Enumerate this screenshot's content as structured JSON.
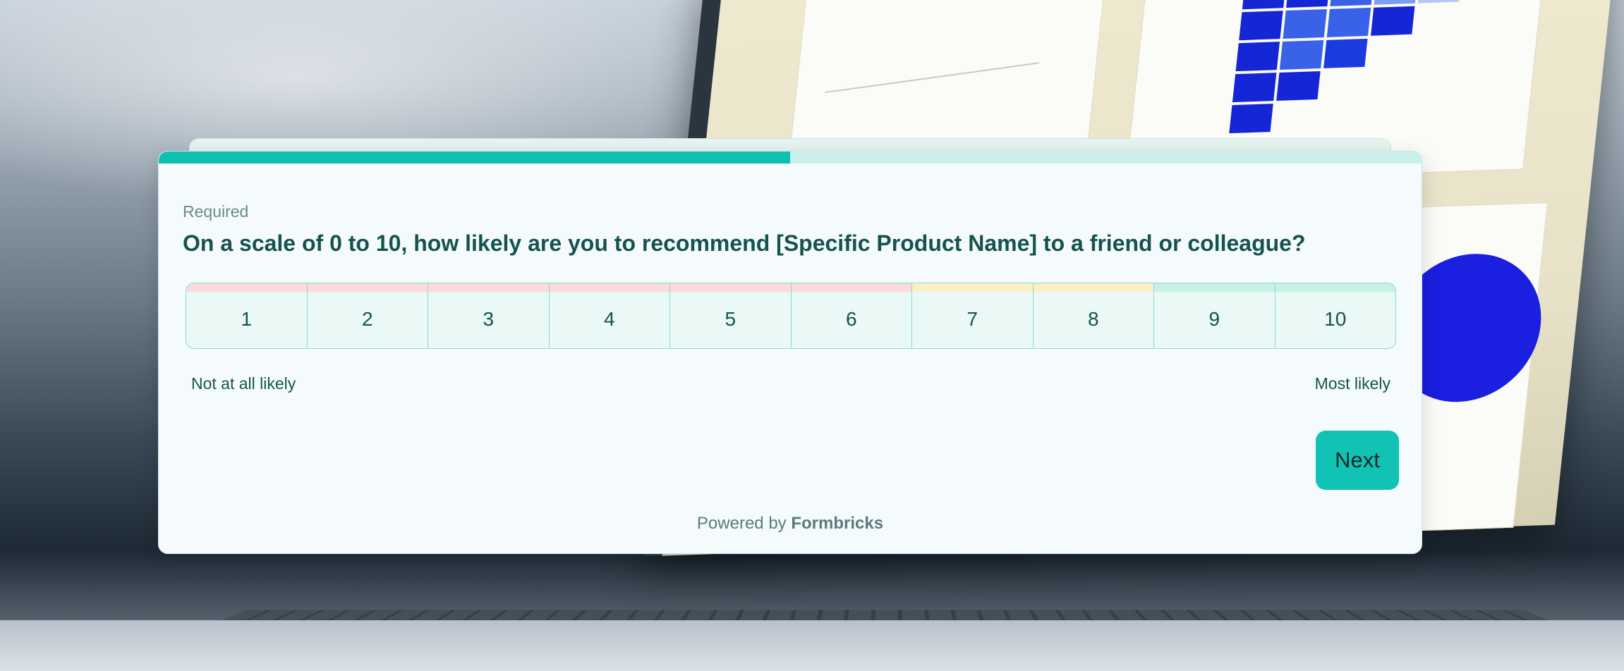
{
  "survey": {
    "progress_fraction": 0.5,
    "required_label": "Required",
    "question": "On a scale of 0 to 10, how likely are you to recommend [Specific Product Name] to a friend or colleague?",
    "scale_options": [
      {
        "label": "1",
        "tint": "#fcd9dd"
      },
      {
        "label": "2",
        "tint": "#fcd9dd"
      },
      {
        "label": "3",
        "tint": "#fcd9dd"
      },
      {
        "label": "4",
        "tint": "#fcd9dd"
      },
      {
        "label": "5",
        "tint": "#fcd9dd"
      },
      {
        "label": "6",
        "tint": "#fcd9dd"
      },
      {
        "label": "7",
        "tint": "#fdeec4"
      },
      {
        "label": "8",
        "tint": "#fdeec4"
      },
      {
        "label": "9",
        "tint": "#c8f1e4"
      },
      {
        "label": "10",
        "tint": "#c8f1e4"
      }
    ],
    "lower_label": "Not at all likely",
    "upper_label": "Most likely",
    "next_label": "Next",
    "powered_prefix": "Powered by",
    "powered_brand": "Formbricks"
  },
  "colors": {
    "accent": "#10c3b4",
    "progress_track": "#c9efea",
    "text": "#15534f"
  }
}
